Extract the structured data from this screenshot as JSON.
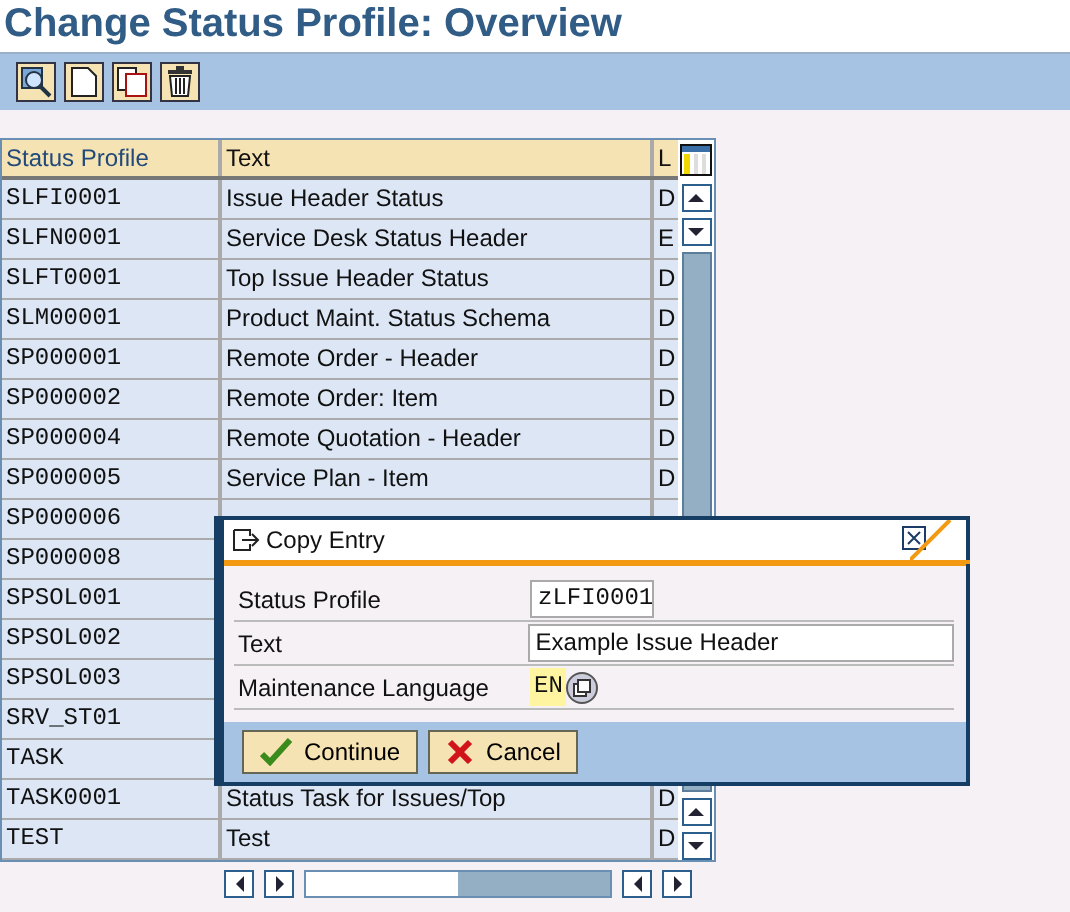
{
  "title": "Change Status Profile: Overview",
  "toolbar": [
    {
      "kind": "details"
    },
    {
      "kind": "new"
    },
    {
      "kind": "copy"
    },
    {
      "kind": "delete"
    }
  ],
  "table": {
    "columns": [
      "Status Profile",
      "Text",
      "L"
    ],
    "rows": [
      {
        "profile": "SLFI0001",
        "text": "Issue Header Status",
        "lang": "D"
      },
      {
        "profile": "SLFN0001",
        "text": "Service Desk Status Header",
        "lang": "E"
      },
      {
        "profile": "SLFT0001",
        "text": "Top Issue Header Status",
        "lang": "D"
      },
      {
        "profile": "SLM00001",
        "text": "Product Maint. Status Schema",
        "lang": "D"
      },
      {
        "profile": "SP000001",
        "text": "Remote Order - Header",
        "lang": "D"
      },
      {
        "profile": "SP000002",
        "text": "Remote Order: Item",
        "lang": "D"
      },
      {
        "profile": "SP000004",
        "text": "Remote Quotation - Header",
        "lang": "D"
      },
      {
        "profile": "SP000005",
        "text": "Service Plan - Item",
        "lang": "D"
      },
      {
        "profile": "SP000006"
      },
      {
        "profile": "SP000008"
      },
      {
        "profile": "SPSOL001"
      },
      {
        "profile": "SPSOL002"
      },
      {
        "profile": "SPSOL003"
      },
      {
        "profile": "SRV_ST01"
      },
      {
        "profile": "TASK"
      },
      {
        "profile": "TASK0001",
        "text": "Status Task for Issues/Top",
        "lang": "D"
      },
      {
        "profile": "TEST",
        "text": "Test",
        "lang": "D"
      }
    ]
  },
  "dialog": {
    "title": "Copy Entry",
    "fields": [
      {
        "label": "Status Profile",
        "value": "zLFI0001",
        "kind": "short"
      },
      {
        "label": "Text",
        "value": "Example Issue Header",
        "kind": "long"
      },
      {
        "label": "Maintenance Language",
        "value": "EN",
        "kind": "lang"
      }
    ],
    "buttons": [
      {
        "label": "Continue",
        "kind": "ok"
      },
      {
        "label": "Cancel",
        "kind": "cancel"
      }
    ]
  }
}
